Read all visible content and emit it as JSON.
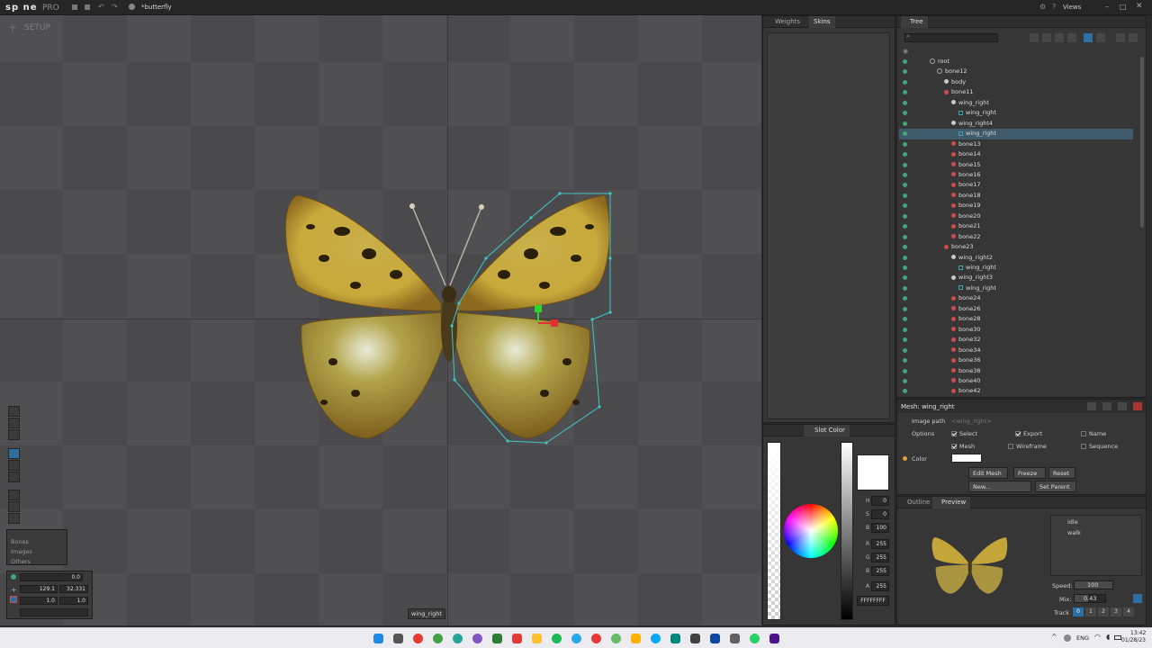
{
  "app": {
    "logo_text": "sp ne",
    "edition": "PRO",
    "file_name": "*butterfly",
    "views_label": "Views"
  },
  "viewport": {
    "mode_label": "SETUP",
    "tooltip": "wing_right",
    "filters": [
      "Bones",
      "Images",
      "Others"
    ],
    "transform": {
      "rotate": "0.0",
      "translate_x": "129.1",
      "translate_y": "32.331",
      "scale_x": "1.0",
      "scale_y": "1.0"
    }
  },
  "weights_panel": {
    "tabs": [
      "Weights",
      "Skins"
    ]
  },
  "tree": {
    "tab_label": "Tree",
    "rows": [
      {
        "label": "root",
        "type": "root",
        "indent": 0
      },
      {
        "label": "bone12",
        "type": "bone-outline",
        "indent": 1
      },
      {
        "label": "body",
        "type": "slot",
        "indent": 2
      },
      {
        "label": "bone11",
        "type": "bone",
        "indent": 2
      },
      {
        "label": "wing_right",
        "type": "slot",
        "indent": 3
      },
      {
        "label": "wing_right",
        "type": "attachment",
        "indent": 4
      },
      {
        "label": "wing_right4",
        "type": "slot",
        "indent": 3
      },
      {
        "label": "wing_right",
        "type": "attachment",
        "indent": 4,
        "selected": true
      },
      {
        "label": "bone13",
        "type": "bone",
        "indent": 3
      },
      {
        "label": "bone14",
        "type": "bone",
        "indent": 3
      },
      {
        "label": "bone15",
        "type": "bone",
        "indent": 3
      },
      {
        "label": "bone16",
        "type": "bone",
        "indent": 3
      },
      {
        "label": "bone17",
        "type": "bone",
        "indent": 3
      },
      {
        "label": "bone18",
        "type": "bone",
        "indent": 3
      },
      {
        "label": "bone19",
        "type": "bone",
        "indent": 3
      },
      {
        "label": "bone20",
        "type": "bone",
        "indent": 3
      },
      {
        "label": "bone21",
        "type": "bone",
        "indent": 3
      },
      {
        "label": "bone22",
        "type": "bone",
        "indent": 3
      },
      {
        "label": "bone23",
        "type": "bone",
        "indent": 2
      },
      {
        "label": "wing_right2",
        "type": "slot",
        "indent": 3
      },
      {
        "label": "wing_right",
        "type": "attachment",
        "indent": 4
      },
      {
        "label": "wing_right3",
        "type": "slot",
        "indent": 3
      },
      {
        "label": "wing_right",
        "type": "attachment",
        "indent": 4
      },
      {
        "label": "bone24",
        "type": "bone",
        "indent": 3
      },
      {
        "label": "bone26",
        "type": "bone",
        "indent": 3
      },
      {
        "label": "bone28",
        "type": "bone",
        "indent": 3
      },
      {
        "label": "bone30",
        "type": "bone",
        "indent": 3
      },
      {
        "label": "bone32",
        "type": "bone",
        "indent": 3
      },
      {
        "label": "bone34",
        "type": "bone",
        "indent": 3
      },
      {
        "label": "bone36",
        "type": "bone",
        "indent": 3
      },
      {
        "label": "bone38",
        "type": "bone",
        "indent": 3
      },
      {
        "label": "bone40",
        "type": "bone",
        "indent": 3
      },
      {
        "label": "bone42",
        "type": "bone",
        "indent": 3
      }
    ]
  },
  "properties": {
    "title": "Mesh: wing_right",
    "image_path_label": "Image path",
    "image_path_placeholder": "<wing_right>",
    "options_label": "Options",
    "select_label": "Select",
    "export_label": "Export",
    "name_label": "Name",
    "mesh_label": "Mesh",
    "wireframe_label": "Wireframe",
    "sequence_label": "Sequence",
    "color_label": "Color",
    "edit_mesh_label": "Edit Mesh",
    "freeze_label": "Freeze",
    "reset_label": "Reset",
    "new_label": "New...",
    "set_parent_label": "Set Parent"
  },
  "slot_color": {
    "tab_label": "Slot Color",
    "h_label": "H",
    "h_value": "0",
    "s_label": "S",
    "s_value": "0",
    "b_label": "B",
    "b_value": "100",
    "r_label": "R",
    "r_value": "255",
    "g_label": "G",
    "g_value": "255",
    "bb_label": "B",
    "bb_value": "255",
    "a_label": "A",
    "a_value": "255",
    "hex_value": "FFFFFFFF"
  },
  "preview": {
    "tabs": [
      "Outline",
      "Preview"
    ],
    "animations": [
      "idle",
      "walk"
    ],
    "speed_label": "Speed:",
    "speed_value": "100",
    "mix_label": "Mix:",
    "mix_value": "0.43",
    "track_label": "Track",
    "tracks": [
      "0",
      "1",
      "2",
      "3",
      "4"
    ]
  },
  "taskbar": {
    "lang": "ENG",
    "time": "13:42",
    "date": "01/28/23"
  },
  "colors": {
    "accent": "#2d6ea3",
    "mesh_hull": "#3fc7c0",
    "bone_red": "#d24b4b",
    "slot_green": "#3fa77a"
  }
}
